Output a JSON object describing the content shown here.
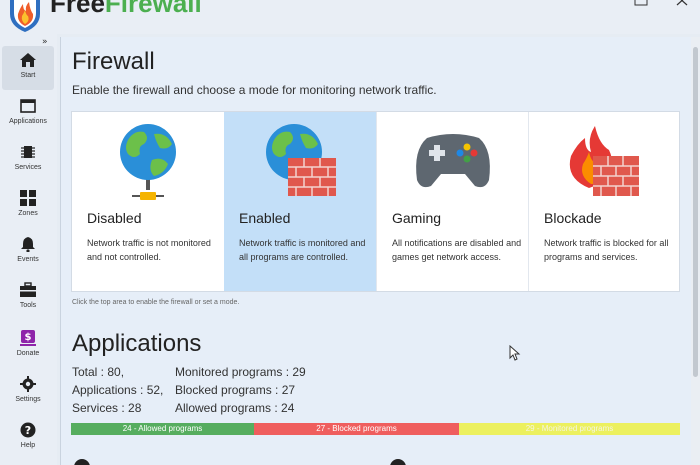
{
  "app": {
    "title_part1": "Free",
    "title_part2": "Firewall"
  },
  "window": {
    "maximize_icon": "maximize-icon",
    "close_icon": "close-icon"
  },
  "sidebar": {
    "collapse_label": "»",
    "items": [
      {
        "label": "Start",
        "icon": "home-icon"
      },
      {
        "label": "Applications",
        "icon": "window-icon"
      },
      {
        "label": "Services",
        "icon": "chip-icon"
      },
      {
        "label": "Zones",
        "icon": "grid-icon"
      },
      {
        "label": "Events",
        "icon": "bell-icon"
      },
      {
        "label": "Tools",
        "icon": "toolbox-icon"
      },
      {
        "label": "Donate",
        "icon": "donate-icon"
      },
      {
        "label": "Settings",
        "icon": "gear-icon"
      },
      {
        "label": "Help",
        "icon": "help-icon"
      }
    ]
  },
  "firewall": {
    "title": "Firewall",
    "subtitle": "Enable the firewall and choose a mode for monitoring network traffic.",
    "modes": [
      {
        "title": "Disabled",
        "desc": "Network traffic is not monitored and not controlled.",
        "icon": "globe-network-icon",
        "selected": false
      },
      {
        "title": "Enabled",
        "desc": "Network traffic is monitored and all programs are controlled.",
        "icon": "globe-firewall-icon",
        "selected": true
      },
      {
        "title": "Gaming",
        "desc": "All notifications are disabled and games get network access.",
        "icon": "gamepad-icon",
        "selected": false
      },
      {
        "title": "Blockade",
        "desc": "Network traffic is blocked for all programs and services.",
        "icon": "fire-wall-icon",
        "selected": false
      }
    ],
    "hint": "Click the top area to enable the firewall or set a mode."
  },
  "applications": {
    "title": "Applications",
    "total": "Total : 80,",
    "applications": "Applications : 52,",
    "services": "Services : 28",
    "monitored": "Monitored programs : 29",
    "blocked": "Blocked programs : 27",
    "allowed": "Allowed programs : 24",
    "bar": {
      "allowed_label": "24 - Allowed programs",
      "blocked_label": "27 - Blocked programs",
      "monitored_label": "29 - Monitored programs",
      "allowed": 24,
      "blocked": 27,
      "monitored": 29
    }
  },
  "colors": {
    "allowed": "#56ad5f",
    "blocked": "#ef5e5e",
    "monitored": "#ecf05f",
    "selected": "#c3dff8",
    "brand_green": "#4caf50"
  }
}
